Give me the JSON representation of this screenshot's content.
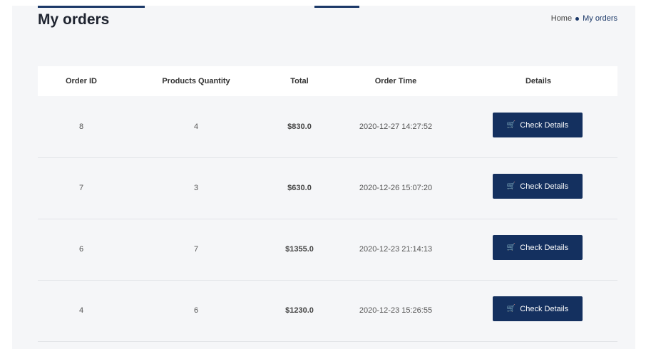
{
  "header": {
    "title": "My orders",
    "breadcrumb": {
      "home": "Home",
      "current": "My orders"
    }
  },
  "table": {
    "columns": [
      "Order ID",
      "Products Quantity",
      "Total",
      "Order Time",
      "Details"
    ],
    "rows": [
      {
        "id": "8",
        "quantity": "4",
        "total": "$830.0",
        "time": "2020-12-27 14:27:52",
        "action": "Check Details"
      },
      {
        "id": "7",
        "quantity": "3",
        "total": "$630.0",
        "time": "2020-12-26 15:07:20",
        "action": "Check Details"
      },
      {
        "id": "6",
        "quantity": "7",
        "total": "$1355.0",
        "time": "2020-12-23 21:14:13",
        "action": "Check Details"
      },
      {
        "id": "4",
        "quantity": "6",
        "total": "$1230.0",
        "time": "2020-12-23 15:26:55",
        "action": "Check Details"
      }
    ]
  },
  "icons": {
    "cart": "cart-icon"
  },
  "colors": {
    "accent": "#14305f",
    "panel_bg": "#f5f6f8"
  }
}
